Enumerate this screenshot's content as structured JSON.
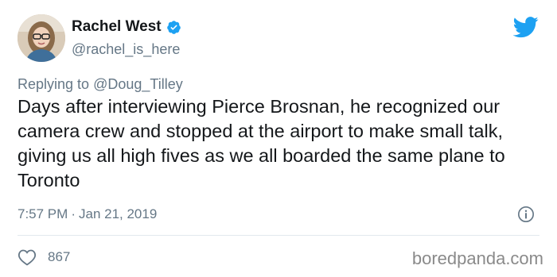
{
  "author": {
    "name": "Rachel West",
    "handle": "@rachel_is_here"
  },
  "reply": {
    "prefix": "Replying to",
    "mention": "@Doug_Tilley"
  },
  "tweet": {
    "text": "Days after interviewing Pierce Brosnan, he recognized our camera crew and stopped at the airport to make small talk, giving us all high fives as we all boarded the same plane to Toronto",
    "time": "7:57 PM",
    "separator": "·",
    "date": "Jan 21, 2019"
  },
  "engagement": {
    "likes": "867"
  },
  "watermark": "boredpanda.com",
  "colors": {
    "twitter_blue": "#1da1f2",
    "muted_text": "#657786",
    "body_text": "#14171a"
  },
  "icons": {
    "verified": "verified-badge-icon",
    "logo": "twitter-bird-icon",
    "info": "info-icon",
    "like": "heart-icon"
  }
}
